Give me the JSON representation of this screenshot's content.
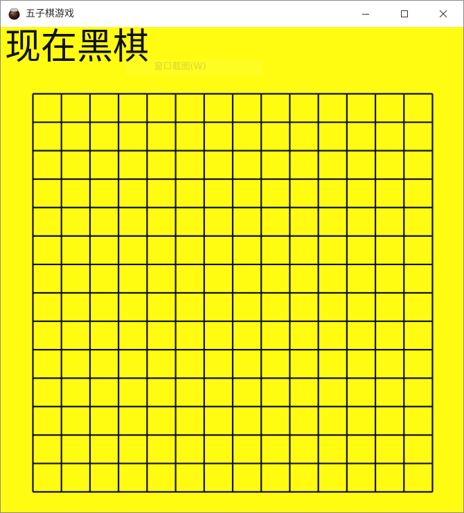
{
  "window": {
    "title": "五子棋游戏",
    "icon": "go-stone-jar-icon",
    "controls": {
      "minimize": "minimize-icon",
      "maximize": "maximize-icon",
      "close": "close-icon"
    }
  },
  "game": {
    "status_text": "现在黑棋",
    "ghost_tooltip": "窗口截图(W)",
    "board_background": "#fffc12",
    "line_color": "#111111",
    "grid_columns": 14,
    "grid_rows": 14
  }
}
